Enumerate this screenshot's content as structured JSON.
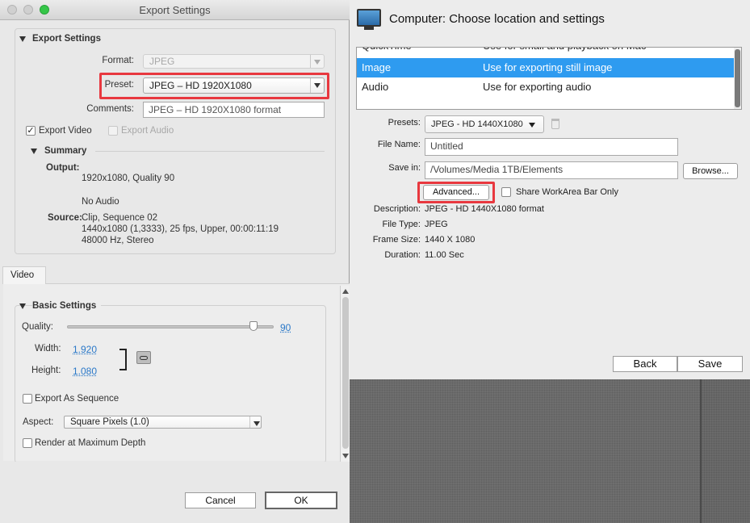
{
  "left_dialog": {
    "title": "Export Settings",
    "export_settings_header": "Export Settings",
    "format_label": "Format:",
    "format_value": "JPEG",
    "preset_label": "Preset:",
    "preset_value": "JPEG – HD 1920X1080",
    "comments_label": "Comments:",
    "comments_value": "JPEG – HD 1920X1080 format",
    "export_video_label": "Export Video",
    "export_video_checked": true,
    "export_audio_label": "Export Audio",
    "export_audio_checked": false,
    "summary_header": "Summary",
    "output_label": "Output:",
    "output_line1": "1920x1080, Quality 90",
    "output_line2": "No Audio",
    "source_label": "Source:",
    "source_line1": "Clip, Sequence 02",
    "source_line2": "1440x1080 (1,3333), 25 fps, Upper, 00:00:11:19",
    "source_line3": "48000 Hz, Stereo",
    "video_tab": "Video",
    "basic_settings_header": "Basic Settings",
    "quality_label": "Quality:",
    "quality_value": "90",
    "quality_percent": 90,
    "width_label": "Width:",
    "width_value": "1.920",
    "height_label": "Height:",
    "height_value": "1.080",
    "export_sequence_label": "Export As Sequence",
    "aspect_label": "Aspect:",
    "aspect_value": "Square Pixels (1.0)",
    "render_max_depth_label": "Render at Maximum Depth",
    "cancel_label": "Cancel",
    "ok_label": "OK"
  },
  "right_panel": {
    "title": "Computer: Choose location and settings",
    "list_items": [
      {
        "name": "QuickTime",
        "desc": "Use for small and playback on Mac"
      },
      {
        "name": "Image",
        "desc": "Use for exporting  still image"
      },
      {
        "name": "Audio",
        "desc": "Use for exporting audio"
      }
    ],
    "selected_index": 1,
    "presets_label": "Presets:",
    "presets_value": "JPEG - HD 1440X1080",
    "file_name_label": "File Name:",
    "file_name_value": "Untitled",
    "save_in_label": "Save in:",
    "save_in_value": "/Volumes/Media 1TB/Elements",
    "browse_label": "Browse...",
    "advanced_label": "Advanced...",
    "share_workarea_label": "Share WorkArea Bar Only",
    "description_label": "Description:",
    "description_value": "JPEG - HD 1440X1080 format",
    "file_type_label": "File Type:",
    "file_type_value": "JPEG",
    "frame_size_label": "Frame Size:",
    "frame_size_value": "1440 X 1080",
    "duration_label": "Duration:",
    "duration_value": "11.00 Sec",
    "back_label": "Back",
    "save_label": "Save"
  },
  "colors": {
    "highlight": "#e8383f",
    "selection": "#2e9bf0",
    "link": "#2a78c8"
  }
}
